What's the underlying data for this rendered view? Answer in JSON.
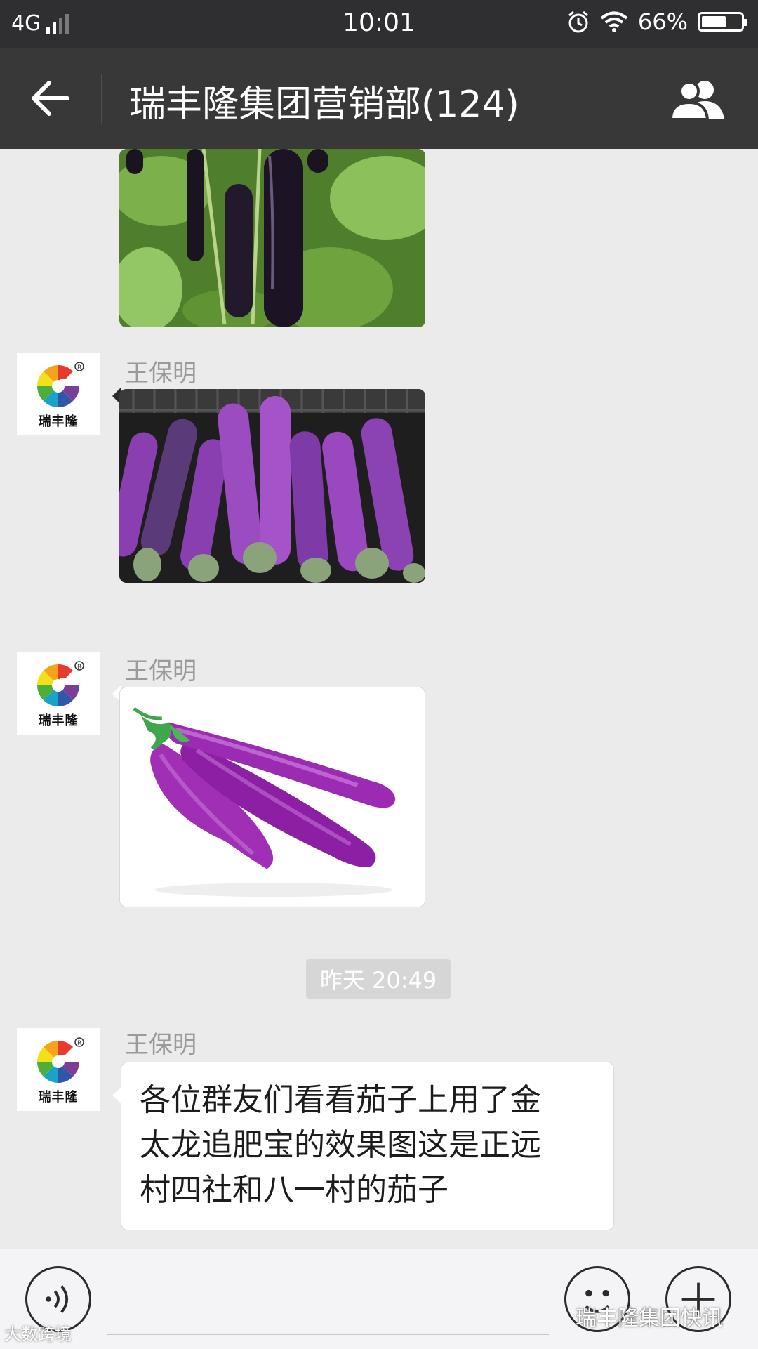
{
  "status_bar": {
    "network": "4G",
    "time": "10:01",
    "battery_percent": "66%",
    "battery_level": 0.66,
    "icons": [
      "signal-icon",
      "alarm-icon",
      "wifi-icon",
      "battery-icon"
    ]
  },
  "nav": {
    "title": "瑞丰隆集团营销部(124)",
    "back_icon": "arrow-left-icon",
    "members_icon": "group-members-icon"
  },
  "avatar_label": "瑞丰隆",
  "messages": [
    {
      "type": "image",
      "subject": "dark purple eggplants on the vine"
    },
    {
      "type": "image",
      "sender": "王保明",
      "subject": "long purple eggplants in a crate"
    },
    {
      "type": "image",
      "sender": "王保明",
      "subject": "three long purple eggplants on white"
    },
    {
      "type": "timestamp",
      "text": "昨天 20:49"
    },
    {
      "type": "text",
      "sender": "王保明",
      "lines": [
        "各位群友们看看茄子上用了金",
        "太龙追肥宝的效果图这是正远",
        "村四社和八一村的茄子"
      ]
    }
  ],
  "input_bar": {
    "voice_icon": "voice-icon",
    "emoji_icon": "emoji-icon",
    "plus_icon": "plus-icon"
  },
  "watermarks": {
    "left": "大数跨境",
    "right": "瑞丰隆集团快讯"
  },
  "colors": {
    "status_bg": "#2f2f31",
    "nav_bg": "#383838",
    "chat_bg": "#ebebeb",
    "bubble": "#ffffff"
  }
}
